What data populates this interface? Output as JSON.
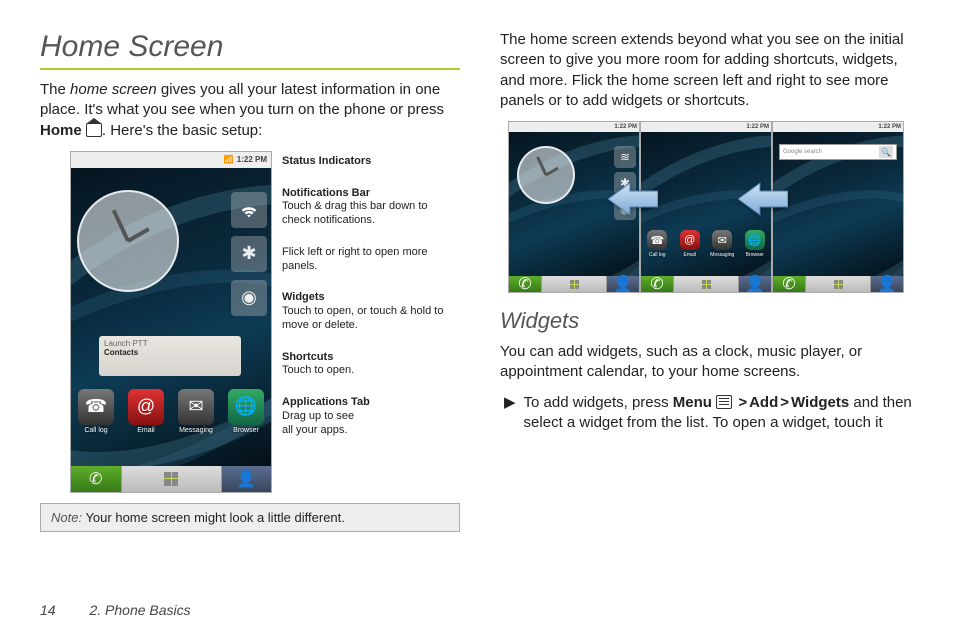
{
  "left": {
    "heading": "Home Screen",
    "intro_a": "The ",
    "intro_em": "home screen",
    "intro_b": " gives you all your latest information in one place. It's what you see when you turn on the phone or press ",
    "intro_home": "Home",
    "intro_c": ". Here's the basic setup:",
    "note_lead": "Note:",
    "note_body": " Your home screen might look a little different."
  },
  "callouts": {
    "status": "Status Indicators",
    "notif_t": "Notifications Bar",
    "notif_b": "Touch & drag this bar down to check notifications.",
    "flick": "Flick left or right to open more panels.",
    "widgets_t": "Widgets",
    "widgets_b": "Touch to open, or touch & hold to move or delete.",
    "short_t": "Shortcuts",
    "short_b": "Touch to open.",
    "apps_t": "Applications Tab",
    "apps_b1": "Drag up to see",
    "apps_b2": "all your apps."
  },
  "phone": {
    "status_time": "1:22 PM",
    "widget_l1": "Launch PTT",
    "widget_l2": "Contacts",
    "shortcuts": [
      "Call log",
      "Email",
      "Messaging",
      "Browser"
    ],
    "search_placeholder": "Google search"
  },
  "right": {
    "para1": "The home screen extends beyond what you see on the initial screen to give you more room for adding shortcuts, widgets, and more. Flick the home screen left and right to see more panels or to add widgets or shortcuts.",
    "h2": "Widgets",
    "para2": "You can add widgets, such as a clock, music player, or appointment calendar, to your home screens.",
    "bullet_a": "To add widgets, press ",
    "bullet_menu": "Menu",
    "bullet_add": "Add",
    "bullet_widgets": "Widgets",
    "bullet_b": " and then select a widget from the list. To open a widget, touch it"
  },
  "footer": {
    "page": "14",
    "section": "2. Phone Basics"
  }
}
